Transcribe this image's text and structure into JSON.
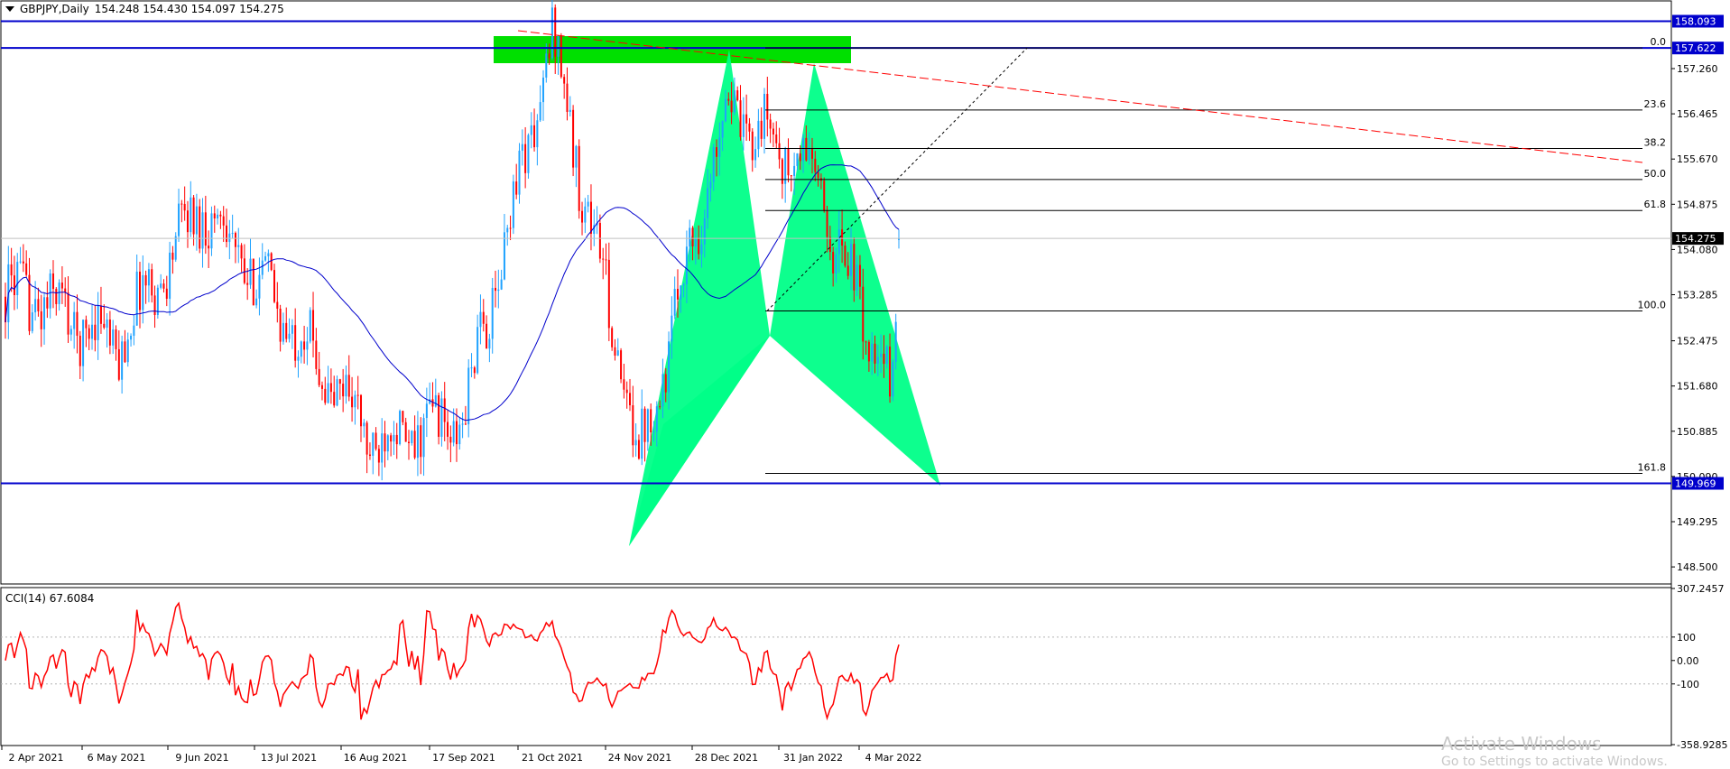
{
  "header": {
    "symbol": "GBPJPY,Daily",
    "ohlc": "154.248 154.430 154.097 154.275",
    "menu_icon": "triangle-down-icon"
  },
  "indicator": {
    "label": "CCI(14) 67.6084"
  },
  "watermark": {
    "title": "Activate Windows",
    "subtitle": "Go to Settings to activate Windows."
  },
  "colors": {
    "bull": "#1fa2ff",
    "bear": "#ff0000",
    "ma": "#0000cc",
    "pattern": "#00ff88",
    "zone": "#00e000",
    "hline": "#0000cc",
    "trend": "#ff0000",
    "cci": "#ff0000",
    "tag_blue": "#0000cc",
    "tag_black": "#000000"
  },
  "price_axis": {
    "ticks": [
      "157.260",
      "156.465",
      "155.670",
      "154.875",
      "154.080",
      "153.285",
      "152.475",
      "151.680",
      "150.885",
      "150.090",
      "149.295",
      "148.500"
    ],
    "tags": [
      {
        "label": "158.093",
        "style": "blue"
      },
      {
        "label": "157.622",
        "style": "blue"
      },
      {
        "label": "154.275",
        "style": "black"
      },
      {
        "label": "149.969",
        "style": "blue"
      }
    ]
  },
  "fib_levels": [
    "0.0",
    "23.6",
    "38.2",
    "50.0",
    "61.8",
    "100.0",
    "161.8"
  ],
  "cci_axis": {
    "ticks": [
      "307.2457",
      "100",
      "0.00",
      "-100",
      "-358.9285"
    ]
  },
  "time_axis": {
    "labels": [
      "2 Apr 2021",
      "6 May 2021",
      "9 Jun 2021",
      "13 Jul 2021",
      "16 Aug 2021",
      "17 Sep 2021",
      "21 Oct 2021",
      "24 Nov 2021",
      "28 Dec 2021",
      "31 Jan 2022",
      "4 Mar 2022"
    ]
  },
  "chart_data": {
    "type": "candlestick",
    "symbol": "GBPJPY",
    "timeframe": "Daily",
    "last": {
      "open": 154.248,
      "high": 154.43,
      "low": 154.097,
      "close": 154.275
    },
    "ylim": [
      148.2,
      158.45
    ],
    "horizontal_levels": [
      158.093,
      157.622,
      149.969
    ],
    "fib_retracement": {
      "high": 157.622,
      "low": 153.0,
      "levels": [
        0,
        23.6,
        38.2,
        50.0,
        61.8,
        100.0,
        161.8
      ]
    },
    "anchors": [
      {
        "date": "2 Apr 2021",
        "close": 153.25
      },
      {
        "date": "6 May 2021",
        "close": 152.4
      },
      {
        "date": "9 Jun 2021",
        "close": 154.9
      },
      {
        "date": "13 Jul 2021",
        "close": 152.8
      },
      {
        "date": "16 Aug 2021",
        "close": 150.7
      },
      {
        "date": "17 Sep 2021",
        "close": 151.1
      },
      {
        "date": "21 Oct 2021",
        "close": 157.8
      },
      {
        "date": "24 Nov 2021",
        "close": 150.4
      },
      {
        "date": "28 Dec 2021",
        "close": 156.6
      },
      {
        "date": "31 Jan 2022",
        "close": 155.4
      },
      {
        "date": "4 Mar 2022",
        "close": 151.4
      },
      {
        "date": "4 Mar 2022",
        "close": 154.275
      }
    ],
    "cci": {
      "period": 14,
      "last": 67.6084,
      "ylim": [
        -358.9285,
        307.2457
      ]
    }
  }
}
